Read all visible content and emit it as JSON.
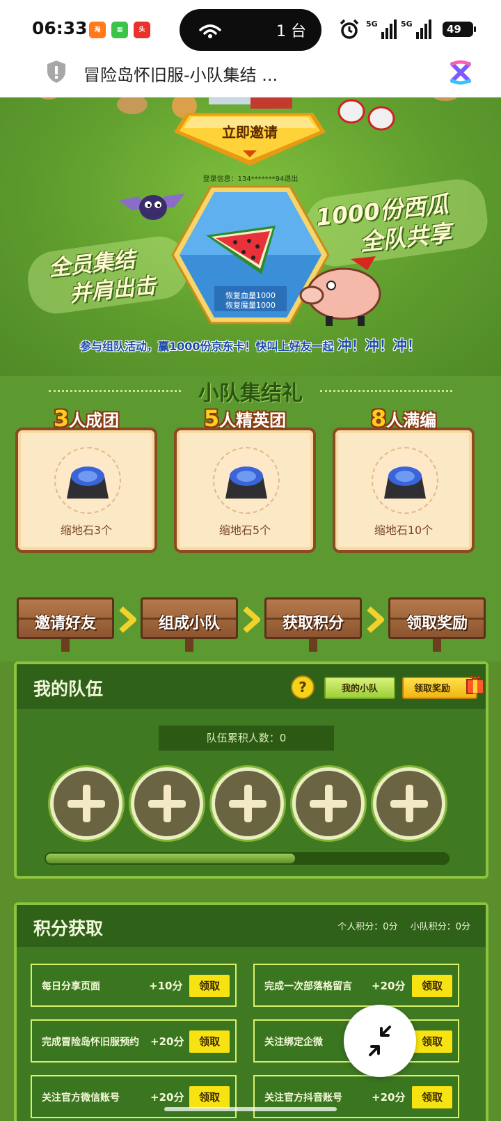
{
  "status_bar": {
    "time": "06:33",
    "app_icons": [
      "淘宝闪购",
      "应用",
      "头条"
    ],
    "island_text": "1 台",
    "signal_labels": [
      "5G",
      "5G"
    ],
    "battery": "49"
  },
  "url_bar": {
    "title": "冒险岛怀旧服-小队集结 ..."
  },
  "hero": {
    "invite_button": "立即邀请",
    "login_info": "登录信息：134*******94退出",
    "reward_line_1": "恢复血量1000",
    "reward_line_2": "恢复魔量1000",
    "slogan_left_1": "全员集结",
    "slogan_left_2": "并肩出击",
    "slogan_right_1": "1000份西瓜",
    "slogan_right_2": "全队共享",
    "tagline_main": "参与组队活动，赢1000份京东卡！快叫上好友一起",
    "tagline_emph": "冲！冲！冲！"
  },
  "gift": {
    "title": "小队集结礼",
    "cards": [
      {
        "num": "3",
        "label": "人成团",
        "reward": "缩地石3个"
      },
      {
        "num": "5",
        "label": "人精英团",
        "reward": "缩地石5个"
      },
      {
        "num": "8",
        "label": "人满编",
        "reward": "缩地石10个"
      }
    ]
  },
  "steps": [
    "邀请好友",
    "组成小队",
    "获取积分",
    "领取奖励"
  ],
  "team": {
    "title": "我的队伍",
    "help": "?",
    "my_team_button": "我的小队",
    "claim_reward_button": "领取奖励",
    "count_text": "队伍累积人数：0",
    "slots": 5,
    "progress": 0.62
  },
  "points": {
    "title": "积分获取",
    "personal": "个人积分：0分",
    "team": "小队积分：0分",
    "tasks": [
      {
        "name": "每日分享页面",
        "points": "+10分",
        "button": "领取"
      },
      {
        "name": "完成一次部落格留言",
        "points": "+20分",
        "button": "领取"
      },
      {
        "name": "完成冒险岛怀旧服预约",
        "points": "+20分",
        "button": "领取"
      },
      {
        "name": "关注绑定企微",
        "points": "",
        "button": "领取"
      },
      {
        "name": "关注官方微信账号",
        "points": "+20分",
        "button": "领取"
      },
      {
        "name": "关注官方抖音账号",
        "points": "+20分",
        "button": "领取"
      }
    ]
  },
  "colors": {
    "grass": "#5c9930",
    "panel": "#3f7a22",
    "panel_border": "#8cc43f",
    "claim_yellow": "#f8e312",
    "wood": "#8c5530"
  },
  "icons": {
    "shield": "shield-icon",
    "browser_logo": "browser-logo-icon",
    "help": "help-icon",
    "gift": "gift-icon",
    "collapse": "collapse-icon",
    "add": "add-member-icon"
  }
}
